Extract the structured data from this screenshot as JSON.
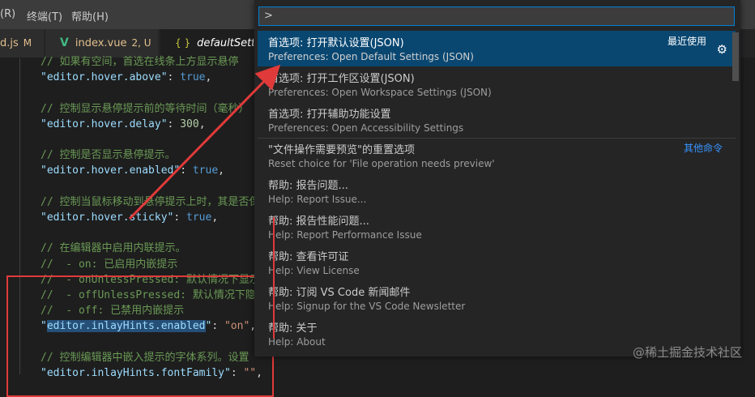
{
  "menubar": {
    "items": [
      "(R)",
      "终端(T)",
      "帮助(H)"
    ]
  },
  "tabs": [
    {
      "name": "d.js",
      "status": "M"
    },
    {
      "name": "index.vue",
      "status": "2, U"
    },
    {
      "name": "defaultSetting",
      "icon": "{ }"
    }
  ],
  "editor": {
    "lines": [
      {
        "parts": [
          {
            "c": "cmt",
            "t": "// 如果有空间，首选在线条上方显示悬停"
          }
        ]
      },
      {
        "parts": [
          {
            "c": "key",
            "t": "\"editor.hover.above\""
          },
          {
            "c": "pun",
            "t": ": "
          },
          {
            "c": "kwv",
            "t": "true"
          },
          {
            "c": "pun",
            "t": ","
          }
        ]
      },
      {
        "parts": []
      },
      {
        "parts": [
          {
            "c": "cmt",
            "t": "// 控制显示悬停提示前的等待时间（毫秒）"
          }
        ]
      },
      {
        "parts": [
          {
            "c": "key",
            "t": "\"editor.hover.delay\""
          },
          {
            "c": "pun",
            "t": ": "
          },
          {
            "c": "num",
            "t": "300"
          },
          {
            "c": "pun",
            "t": ","
          }
        ]
      },
      {
        "parts": []
      },
      {
        "parts": [
          {
            "c": "cmt",
            "t": "// 控制是否显示悬停提示。"
          }
        ]
      },
      {
        "parts": [
          {
            "c": "key",
            "t": "\"editor.hover.enabled\""
          },
          {
            "c": "pun",
            "t": ": "
          },
          {
            "c": "kwv",
            "t": "true"
          },
          {
            "c": "pun",
            "t": ","
          }
        ]
      },
      {
        "parts": []
      },
      {
        "parts": [
          {
            "c": "cmt",
            "t": "// 控制当鼠标移动到悬停提示上时，其是否保持可见。"
          }
        ]
      },
      {
        "parts": [
          {
            "c": "key",
            "t": "\"editor.hover.sticky\""
          },
          {
            "c": "pun",
            "t": ": "
          },
          {
            "c": "kwv",
            "t": "true"
          },
          {
            "c": "pun",
            "t": ","
          }
        ]
      },
      {
        "parts": []
      },
      {
        "parts": [
          {
            "c": "cmt",
            "t": "// 在编辑器中启用内联提示。"
          }
        ]
      },
      {
        "parts": [
          {
            "c": "cmt",
            "t": "//  - on: 已启用内嵌提示"
          }
        ]
      },
      {
        "parts": [
          {
            "c": "cmt",
            "t": "//  - onUnlessPressed: 默认情况下显示"
          }
        ]
      },
      {
        "parts": [
          {
            "c": "cmt",
            "t": "//  - offUnlessPressed: 默认情况下隐藏"
          }
        ]
      },
      {
        "parts": [
          {
            "c": "cmt",
            "t": "//  - off: 已禁用内嵌提示"
          }
        ]
      },
      {
        "parts": [
          {
            "c": "key",
            "t": "\""
          },
          {
            "c": "key sel",
            "t": "editor.inlayHints.enabled"
          },
          {
            "c": "key",
            "t": "\""
          },
          {
            "c": "pun",
            "t": ": "
          },
          {
            "c": "str",
            "t": "\"on\""
          },
          {
            "c": "pun",
            "t": ","
          }
        ]
      },
      {
        "parts": []
      },
      {
        "parts": [
          {
            "c": "cmt",
            "t": "// 控制编辑器中嵌入提示的字体系列。设置"
          }
        ]
      },
      {
        "parts": [
          {
            "c": "key",
            "t": "\"editor.inlayHints.fontFamily\""
          },
          {
            "c": "pun",
            "t": ": "
          },
          {
            "c": "str",
            "t": "\"\""
          },
          {
            "c": "pun",
            "t": ","
          }
        ]
      }
    ]
  },
  "palette": {
    "input_value": ">",
    "commands": [
      {
        "zh": "首选项: 打开默认设置(JSON)",
        "en": "Preferences: Open Default Settings (JSON)",
        "tag": "最近使用",
        "gear": "⚙",
        "active": true
      },
      {
        "zh": "首选项: 打开工作区设置(JSON)",
        "en": "Preferences: Open Workspace Settings (JSON)"
      },
      {
        "zh": "首选项: 打开辅助功能设置",
        "en": "Preferences: Open Accessibility Settings"
      },
      {
        "zh": "\"文件操作需要预览\"的重置选项",
        "en": "Reset choice for 'File operation needs preview'",
        "tag": "其他命令",
        "tag_blue": true,
        "sep_before": true
      },
      {
        "zh": "帮助: 报告问题...",
        "en": "Help: Report Issue..."
      },
      {
        "zh": "帮助: 报告性能问题...",
        "en": "Help: Report Performance Issue"
      },
      {
        "zh": "帮助: 查看许可证",
        "en": "Help: View License"
      },
      {
        "zh": "帮助: 订阅 VS Code 新闻邮件",
        "en": "Help: Signup for the VS Code Newsletter"
      },
      {
        "zh": "帮助: 关于",
        "en": "Help: About"
      }
    ]
  },
  "watermark": "@稀土掘金技术社区",
  "colors": {
    "accent": "#007fd4",
    "selected_row": "#094771",
    "annotation_red": "#e03a3a"
  }
}
